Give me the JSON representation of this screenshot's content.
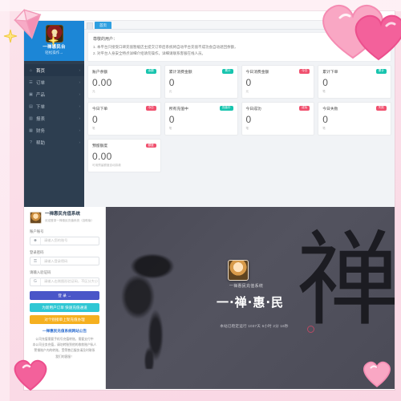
{
  "sidebar": {
    "brand_name": "一禅惠民台",
    "brand_sub": "轻松操作→",
    "logo_icon": "shield-emblem-logo",
    "items": [
      {
        "label": "首页",
        "icon": "home-icon",
        "arrow": "›",
        "active": true
      },
      {
        "label": "订单",
        "icon": "list-icon",
        "arrow": "›",
        "active": false
      },
      {
        "label": "产品",
        "icon": "box-icon",
        "arrow": "›",
        "active": false
      },
      {
        "label": "下单",
        "icon": "cart-icon",
        "arrow": "›",
        "active": false
      },
      {
        "label": "报表",
        "icon": "chart-icon",
        "arrow": "›",
        "active": false
      },
      {
        "label": "财务",
        "icon": "wallet-icon",
        "arrow": "›",
        "active": false
      },
      {
        "label": "帮助",
        "icon": "help-icon",
        "arrow": "›",
        "active": false
      }
    ]
  },
  "topbar": {
    "tab_label": "首页"
  },
  "notice": {
    "title": "尊敬的用户：",
    "line1": "1. 本平台只接受口碑充值暂缓店主提交订单后系统将自动平台充值不成功会自动退回余额，",
    "line2": "2. 对平台人身安全特点详细介绍请勿操作，详细请联系客服在线人员。"
  },
  "cards": [
    {
      "title": "账户余额",
      "badge": "余额",
      "badge_color": "#17c4ae",
      "value": "0.00",
      "sub": "元"
    },
    {
      "title": "累计消费金额",
      "badge": "累计",
      "badge_color": "#17c4ae",
      "value": "0",
      "sub": "元"
    },
    {
      "title": "今日消费金额",
      "badge": "今日",
      "badge_color": "#f0506e",
      "value": "0",
      "sub": "元"
    },
    {
      "title": "累计下单",
      "badge": "累计",
      "badge_color": "#17c4ae",
      "value": "0",
      "sub": "笔"
    },
    {
      "title": "今日下单",
      "badge": "今日",
      "badge_color": "#f0506e",
      "value": "0",
      "sub": "笔"
    },
    {
      "title": "所有充值中",
      "badge": "充值中",
      "badge_color": "#17c4ae",
      "value": "0",
      "sub": "笔"
    },
    {
      "title": "今日成功",
      "badge": "成功",
      "badge_color": "#f0506e",
      "value": "0",
      "sub": "笔"
    },
    {
      "title": "今日失败",
      "badge": "失败",
      "badge_color": "#f0506e",
      "value": "0",
      "sub": "笔"
    },
    {
      "title": "预留额度",
      "badge": "额度",
      "badge_color": "#f0506e",
      "value": "0.00",
      "sub": "可用预留额度自动扣款"
    }
  ],
  "login": {
    "title": "一禅惠民充值系统",
    "subtitle": "欢迎登录一禅惠民充值系统（自助版）",
    "account_label": "账户账号",
    "account_placeholder": "请输入您的账号",
    "password_label": "登录密码",
    "password_placeholder": "请输入登录密码",
    "captcha_label": "请输入验证码",
    "captcha_placeholder": "请输入右侧图形验证码，不区分大小写",
    "captcha_code": "G",
    "account_icon": "user-icon",
    "password_icon": "lock-icon",
    "captcha_icon": "captcha-icon",
    "btn_login": "登 录 →",
    "btn_recharge": "为新用户订单 快速充值通道",
    "btn_query": "对个别接单上架充值办理"
  },
  "announce": {
    "title": "一禅惠民充值系统网站公告",
    "p1": "公司充值需要手机号充值转账，需要支付中",
    "p2": "本公司业务充值，请勿转账到他的收款账户私人",
    "p3": "警惕账户内的转账，受等售后服务请及时联系",
    "p4": "我们的客服！"
  },
  "promo": {
    "glyph": "禅",
    "sysname": "一禅惠民充值系统",
    "brand": "一·禅·惠·民",
    "footer": "本站已稳定运行 1037天 6小时 2分 16秒",
    "avatar_icon": "promo-avatar"
  },
  "decorations": {
    "diamond": "pink-diamond-sticker",
    "heart_top_right": "pink-heart-sticker",
    "heart_bottom_left": "pink-heart-sticker",
    "heart_bottom_right": "pink-heart-sticker",
    "sparkle": "yellow-sparkle-sticker"
  },
  "colors": {
    "sidebar_bg": "#2d3e50",
    "brand_bg": "#1c86d6",
    "accent_teal": "#17c4ae",
    "accent_pink": "#f0506e",
    "btn_login": "#4a56c8",
    "btn_recharge": "#2fc7d4",
    "btn_query": "#f5b020",
    "frame_pink": "#fbdde8"
  }
}
